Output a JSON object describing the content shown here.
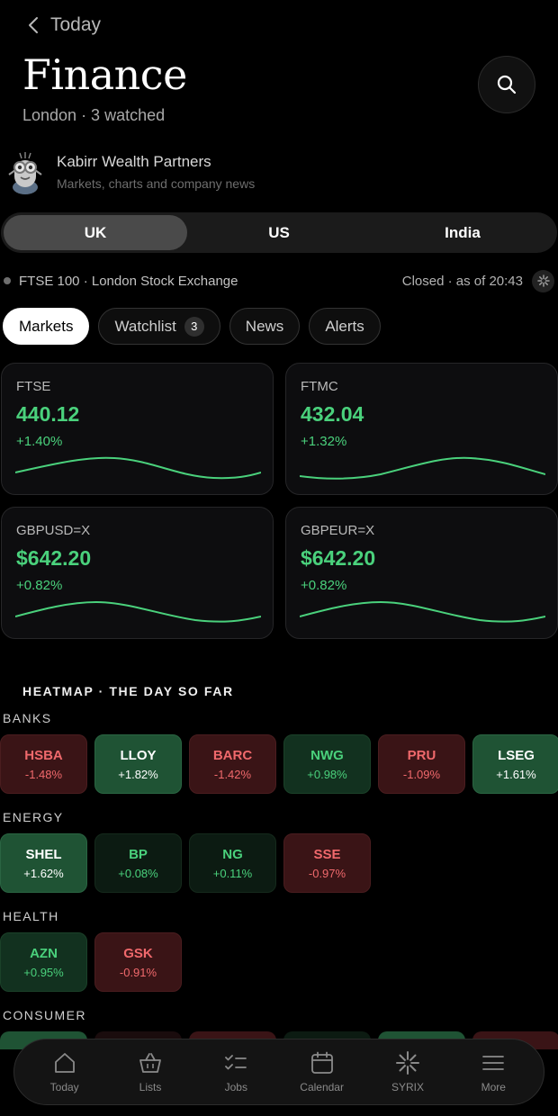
{
  "nav": {
    "back_label": "Today"
  },
  "header": {
    "title": "Finance",
    "subtitle": "London · 3 watched"
  },
  "brand": {
    "name": "Kabirr Wealth Partners",
    "description": "Markets, charts and company news"
  },
  "regions": {
    "selected": "UK",
    "items": [
      "UK",
      "US",
      "India"
    ]
  },
  "market_status": {
    "exchange": "FTSE 100 · London Stock Exchange",
    "status": "Closed · as of 20:43"
  },
  "chips": [
    {
      "label": "Markets",
      "active": true
    },
    {
      "label": "Watchlist",
      "badge": "3"
    },
    {
      "label": "News"
    },
    {
      "label": "Alerts"
    }
  ],
  "cards": [
    {
      "symbol": "FTSE",
      "price": "440.12",
      "change": "+1.40%"
    },
    {
      "symbol": "FTMC",
      "price": "432.04",
      "change": "+1.32%"
    },
    {
      "symbol": "GBPUSD=X",
      "price": "$642.20",
      "change": "+0.82%"
    },
    {
      "symbol": "GBPEUR=X",
      "price": "$642.20",
      "change": "+0.82%"
    }
  ],
  "heatmap": {
    "title": "HEATMAP · THE DAY SO FAR",
    "sectors": [
      {
        "name": "BANKS",
        "tiles": [
          {
            "symbol": "HSBA",
            "change": "-1.48%"
          },
          {
            "symbol": "LLOY",
            "change": "+1.82%"
          },
          {
            "symbol": "BARC",
            "change": "-1.42%"
          },
          {
            "symbol": "NWG",
            "change": "+0.98%"
          },
          {
            "symbol": "PRU",
            "change": "-1.09%"
          },
          {
            "symbol": "LSEG",
            "change": "+1.61%"
          }
        ]
      },
      {
        "name": "ENERGY",
        "tiles": [
          {
            "symbol": "SHEL",
            "change": "+1.62%"
          },
          {
            "symbol": "BP",
            "change": "+0.08%"
          },
          {
            "symbol": "NG",
            "change": "+0.11%"
          },
          {
            "symbol": "SSE",
            "change": "-0.97%"
          }
        ]
      },
      {
        "name": "HEALTH",
        "tiles": [
          {
            "symbol": "AZN",
            "change": "+0.95%"
          },
          {
            "symbol": "GSK",
            "change": "-0.91%"
          }
        ]
      },
      {
        "name": "CONSUMER",
        "tiles": []
      }
    ]
  },
  "tabbar": [
    {
      "label": "Today",
      "icon": "home-icon"
    },
    {
      "label": "Lists",
      "icon": "basket-icon"
    },
    {
      "label": "Jobs",
      "icon": "checklist-icon"
    },
    {
      "label": "Calendar",
      "icon": "calendar-icon"
    },
    {
      "label": "SYRIX",
      "icon": "syrix-icon"
    },
    {
      "label": "More",
      "icon": "menu-icon"
    }
  ],
  "colors": {
    "positive": "#4ad17c",
    "negative": "#f0696c",
    "background": "#000000"
  }
}
